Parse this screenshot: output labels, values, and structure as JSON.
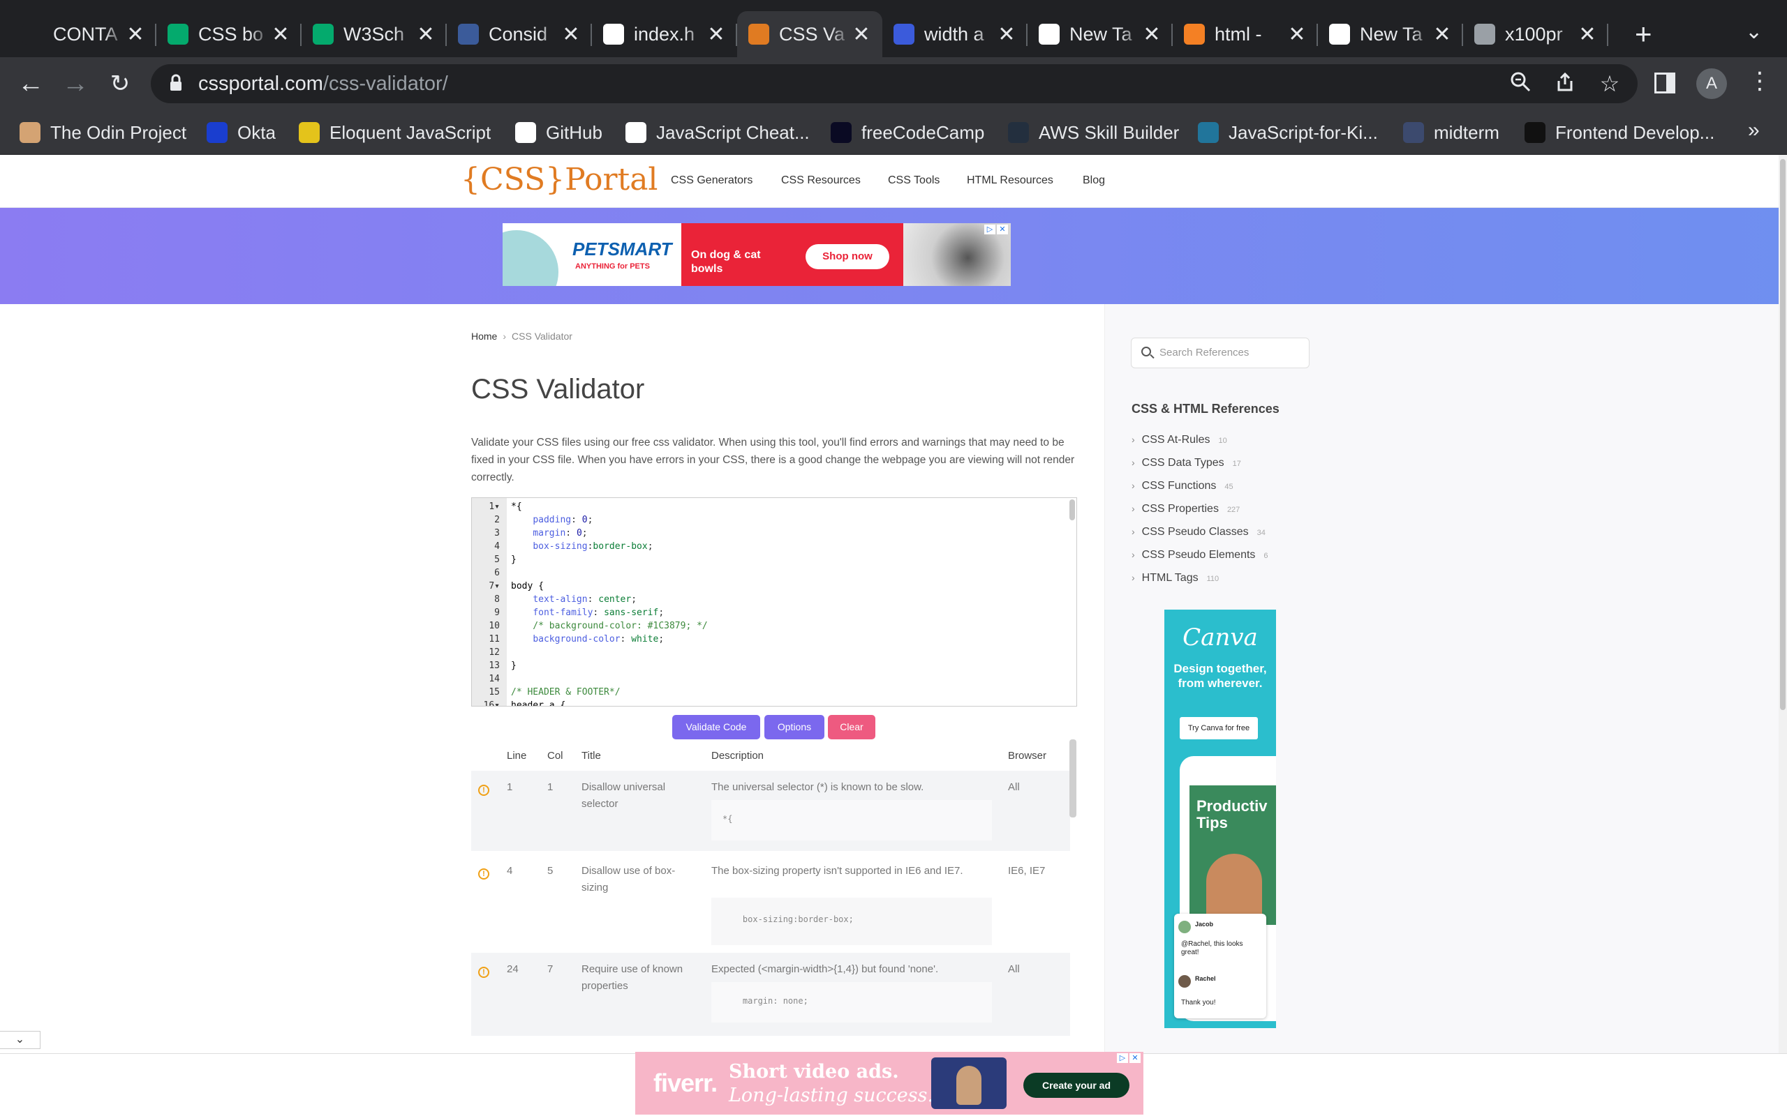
{
  "browser": {
    "tabs": [
      {
        "title": "CONTA",
        "icon": "feather-icon",
        "color": "#202124"
      },
      {
        "title": "CSS bo",
        "icon": "w3schools-icon",
        "color": "#04aa6d"
      },
      {
        "title": "W3Sch",
        "icon": "w3schools-icon",
        "color": "#04aa6d"
      },
      {
        "title": "Consid",
        "icon": "bank-icon",
        "color": "#3b5b9a"
      },
      {
        "title": "index.h",
        "icon": "codepen-icon",
        "color": "#ffffff"
      },
      {
        "title": "CSS Va",
        "icon": "cssportal-icon",
        "color": "#e07b22",
        "active": true
      },
      {
        "title": "width a",
        "icon": "book-icon",
        "color": "#3b5bdb"
      },
      {
        "title": "New Ta",
        "icon": "chrome-icon",
        "color": "#ffffff"
      },
      {
        "title": "html - ",
        "icon": "stackoverflow-icon",
        "color": "#f48024"
      },
      {
        "title": "New Ta",
        "icon": "chrome-icon",
        "color": "#ffffff"
      },
      {
        "title": "x100pr",
        "icon": "globe-icon",
        "color": "#9aa0a6"
      }
    ],
    "url_host": "cssportal.com",
    "url_path": "/css-validator/",
    "profile_initial": "A",
    "bookmarks": [
      {
        "label": "The Odin Project",
        "icon": "odin-icon",
        "color": "#d4a373"
      },
      {
        "label": "Okta",
        "icon": "okta-icon",
        "color": "#1a3ecf"
      },
      {
        "label": "Eloquent JavaScript",
        "icon": "ejs-icon",
        "color": "#e4c31b"
      },
      {
        "label": "GitHub",
        "icon": "github-icon",
        "color": "#ffffff"
      },
      {
        "label": "JavaScript Cheat...",
        "icon": "github-icon",
        "color": "#ffffff"
      },
      {
        "label": "freeCodeCamp",
        "icon": "freecodecamp-icon",
        "color": "#0a0a23"
      },
      {
        "label": "AWS Skill Builder",
        "icon": "aws-icon",
        "color": "#232f3e"
      },
      {
        "label": "JavaScript-for-Ki...",
        "icon": "wordpress-icon",
        "color": "#21759b"
      },
      {
        "label": "midterm",
        "icon": "doc-icon",
        "color": "#3c4a6e"
      },
      {
        "label": "Frontend Develop...",
        "icon": "frontend-icon",
        "color": "#111111"
      }
    ]
  },
  "site": {
    "logo": "{CSS}Portal",
    "nav": [
      "CSS Generators",
      "CSS Resources",
      "CSS Tools",
      "HTML Resources",
      "Blog"
    ]
  },
  "ads": {
    "petsmart": {
      "brand": "PETSMART",
      "tagline": "ANYTHING for PETS",
      "message": "On dog & cat bowls",
      "cta": "Shop now"
    },
    "fiverr": {
      "brand": "fiverr.",
      "line1": "Short video ads.",
      "line2": "Long-lasting success.",
      "cta": "Create your ad"
    },
    "canva": {
      "brand": "Canva",
      "headline": "Design together, from wherever.",
      "cta": "Try Canva for free",
      "card_title": "Productiv Tips",
      "chat_user1": "Jacob",
      "chat_msg1": "@Rachel, this looks great!",
      "chat_user2": "Rachel",
      "chat_msg2": "Thank you!"
    }
  },
  "main": {
    "breadcrumb": {
      "home": "Home",
      "current": "CSS Validator"
    },
    "title": "CSS Validator",
    "intro": "Validate your CSS files using our free css validator. When using this tool, you'll find errors and warnings that may need to be fixed in your CSS file. When you have errors in your CSS, there is a good change the webpage you are viewing will not render correctly.",
    "buttons": {
      "validate": "Validate Code",
      "options": "Options",
      "clear": "Clear"
    },
    "results_headers": {
      "line": "Line",
      "col": "Col",
      "title": "Title",
      "description": "Description",
      "browser": "Browser"
    },
    "results": [
      {
        "line": "1",
        "col": "1",
        "title": "Disallow universal selector",
        "description": "The universal selector (*) is known to be slow.",
        "snippet": "*{",
        "browser": "All"
      },
      {
        "line": "4",
        "col": "5",
        "title": "Disallow use of box-sizing",
        "description": "The box-sizing property isn't supported in IE6 and IE7.",
        "snippet": "    box-sizing:border-box;",
        "browser": "IE6, IE7"
      },
      {
        "line": "24",
        "col": "7",
        "title": "Require use of known properties",
        "description": "Expected (<margin-width>{1,4}) but found 'none'.",
        "snippet": "    margin: none;",
        "browser": "All"
      }
    ]
  },
  "editor_lines": [
    {
      "n": "1",
      "fold": true,
      "text": "*{"
    },
    {
      "n": "2",
      "text": "    padding: 0;"
    },
    {
      "n": "3",
      "text": "    margin: 0;"
    },
    {
      "n": "4",
      "text": "    box-sizing:border-box;"
    },
    {
      "n": "5",
      "text": "}"
    },
    {
      "n": "6",
      "text": ""
    },
    {
      "n": "7",
      "fold": true,
      "text": "body {"
    },
    {
      "n": "8",
      "text": "    text-align: center;"
    },
    {
      "n": "9",
      "text": "    font-family: sans-serif;"
    },
    {
      "n": "10",
      "text": "    /* background-color: #1C3879; */"
    },
    {
      "n": "11",
      "text": "    background-color: white;"
    },
    {
      "n": "12",
      "text": ""
    },
    {
      "n": "13",
      "text": "}"
    },
    {
      "n": "14",
      "text": ""
    },
    {
      "n": "15",
      "text": "/* HEADER & FOOTER*/"
    },
    {
      "n": "16",
      "fold": true,
      "text": "header a {"
    }
  ],
  "sidebar": {
    "search_placeholder": "Search References",
    "heading": "CSS & HTML References",
    "refs": [
      {
        "label": "CSS At-Rules",
        "count": "10"
      },
      {
        "label": "CSS Data Types",
        "count": "17"
      },
      {
        "label": "CSS Functions",
        "count": "45"
      },
      {
        "label": "CSS Properties",
        "count": "227"
      },
      {
        "label": "CSS Pseudo Classes",
        "count": "34"
      },
      {
        "label": "CSS Pseudo Elements",
        "count": "6"
      },
      {
        "label": "HTML Tags",
        "count": "110"
      }
    ]
  },
  "colors": {
    "validate": "#7b68ee",
    "options": "#7b68ee",
    "clear": "#ee5a80",
    "logo": "#e07b22"
  }
}
